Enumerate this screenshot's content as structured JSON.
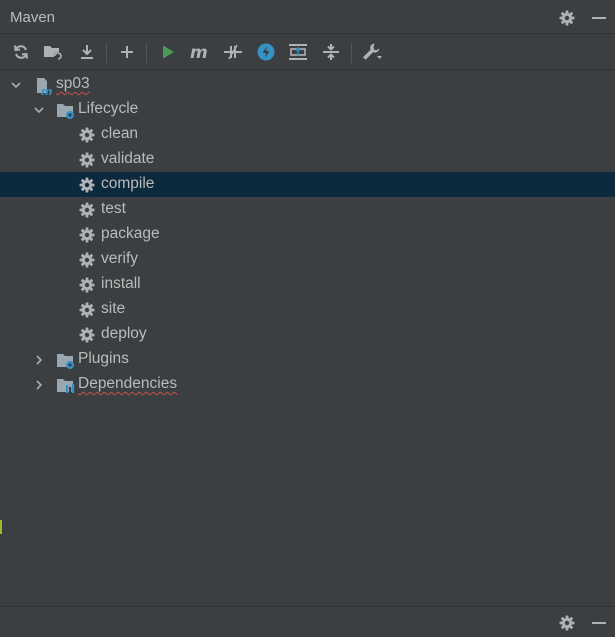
{
  "panel": {
    "title": "Maven"
  },
  "tree": {
    "project": {
      "label": "sp03"
    },
    "lifecycle": {
      "label": "Lifecycle",
      "goals": [
        "clean",
        "validate",
        "compile",
        "test",
        "package",
        "verify",
        "install",
        "site",
        "deploy"
      ],
      "selected": "compile"
    },
    "plugins": {
      "label": "Plugins"
    },
    "dependencies": {
      "label": "Dependencies"
    }
  },
  "icons": {
    "header": [
      "gear-icon",
      "minimize-icon"
    ],
    "toolbar": [
      "reload-icon",
      "add-folder-icon",
      "download-icon",
      "plus-icon",
      "run-icon",
      "maven-m-icon",
      "toggle-offline-icon",
      "skip-tests-icon",
      "show-dependencies-icon",
      "collapse-all-icon",
      "wrench-icon"
    ],
    "footer": [
      "gear-icon",
      "minimize-icon"
    ]
  },
  "colors": {
    "background": "#3c3f41",
    "text": "#bbbbbb",
    "selection": "#0d293e",
    "run_green": "#499c54",
    "accent_blue": "#3592c4",
    "error_squiggle": "#c85050"
  }
}
